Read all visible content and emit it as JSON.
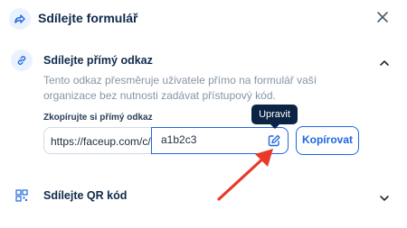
{
  "header": {
    "title": "Sdílejte formulář",
    "icon": "share-icon",
    "close_icon": "close-icon"
  },
  "direct_link": {
    "title": "Sdílejte přímý odkaz",
    "icon": "link-icon",
    "expanded": true,
    "description": "Tento odkaz přesměruje uživatele přímo na formulář vaší organizace bez nutnosti zadávat přístupový kód.",
    "field_label": "Zkopírujte si přímý odkaz",
    "url_prefix": "https://faceup.com/c/",
    "url_value": "a1b2c3",
    "edit_tooltip": "Upravit",
    "copy_label": "Kopírovat"
  },
  "qr_code": {
    "title": "Sdílejte QR kód",
    "icon": "qr-code-icon",
    "expanded": false
  },
  "colors": {
    "accent": "#1f67e0",
    "annotation_arrow": "#e8392b",
    "tooltip_bg": "#0c2443"
  }
}
